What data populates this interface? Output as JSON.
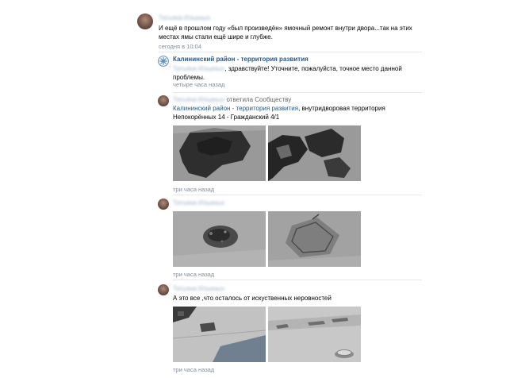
{
  "comments": [
    {
      "author": "Татьяна Ильиных",
      "line1": "И ещё в прошлом году «был произведён» ямочный ремонт внутри двора...так на этих",
      "line2": "местах ямы стали ещё шире и глубже.",
      "time": "сегодня в 10:04"
    },
    {
      "author": "Калининский район - территория развития",
      "addressee": "Татьяна Ильиных",
      "line1_rest": ", здравствуйте! Уточните, пожалуйста, точное место данной",
      "line2": "проблемы.",
      "time": "четыре часа назад"
    },
    {
      "author": "Татьяна Ильиных",
      "action": "ответила Сообществу",
      "mention": "Калининский район - территория развития",
      "line1_rest": ", внутридворовая территория",
      "line2": "Непокорённых 14 - Гражданский 4/1",
      "time": "три часа назад"
    },
    {
      "author": "Татьяна Ильиных",
      "time": "три часа назад"
    },
    {
      "author": "Татьяна Ильиных",
      "line1": "А это все ,что осталось от искуственных неровностей",
      "time": "три часа назад"
    }
  ],
  "colors": {
    "link": "#2a5885",
    "meta": "#818c99",
    "divider": "#e7e8ec",
    "community_logo": "#5b8db8"
  }
}
